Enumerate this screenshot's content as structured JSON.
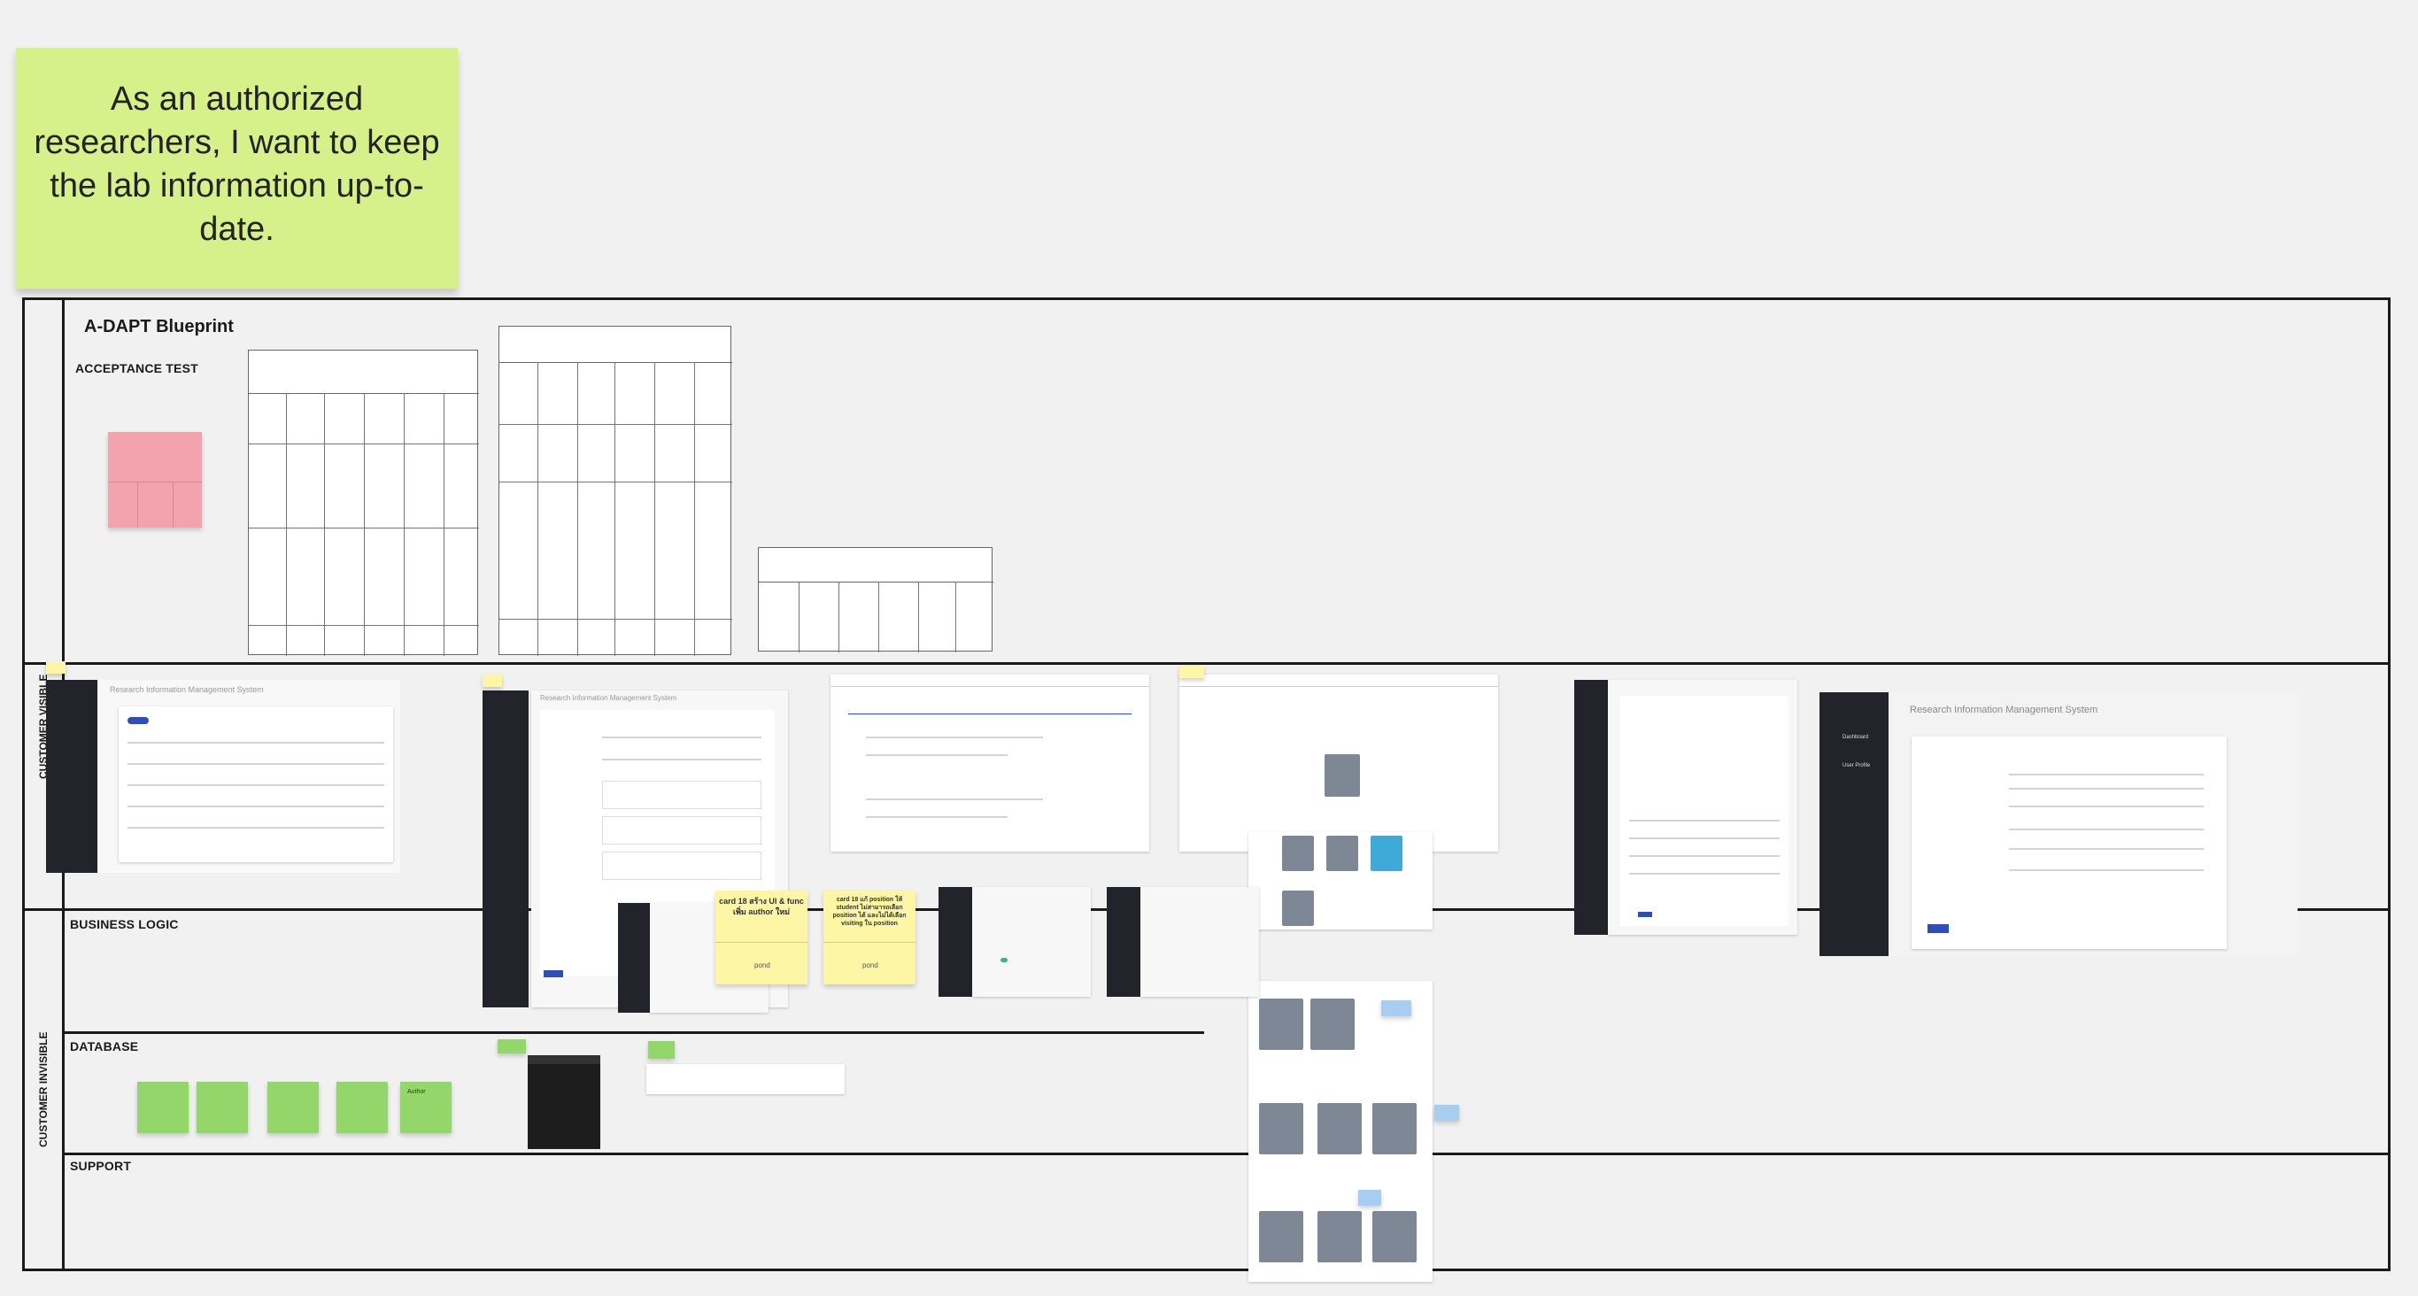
{
  "story_note": {
    "text": "As an authorized researchers, I want to keep the lab information up-to-date."
  },
  "board": {
    "title": "A-DAPT Blueprint",
    "lanes": {
      "acceptance_test": "ACCEPTANCE TEST",
      "business_logic": "BUSINESS LOGIC",
      "database": "DATABASE",
      "support": "SUPPORT"
    },
    "side_labels": {
      "visible": "CUSTOMER VISIBLE",
      "invisible": "CUSTOMER INVISIBLE"
    }
  },
  "screens": {
    "app_title": "Research Information Management System",
    "detail_title": "Research Information Management System"
  },
  "notes": {
    "card18_author": "card 18 สร้าง UI & func เพิ่ม author ใหม่",
    "card18_position": "card 18 แก้ position ให้ student ไม่สามารถเลือก position ได้ และไม่ได้เลือก visiting ใน position",
    "pond": "pond",
    "db_author": "Author"
  },
  "sidebar": {
    "dashboard": "Dashboard",
    "users": "User Profile"
  },
  "colors": {
    "sticky_lime": "#d6f08a",
    "sticky_pink": "#f3a3ae",
    "sticky_green": "#93d66a",
    "sticky_yellow": "#fdf6a4",
    "accent_blue": "#2e4ebd",
    "dark_sidebar": "#23232b"
  }
}
